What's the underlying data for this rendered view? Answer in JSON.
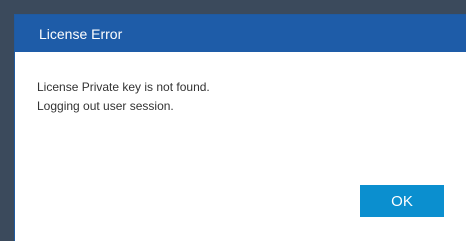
{
  "dialog": {
    "title": "License Error",
    "message_line1": "License Private key is not found.",
    "message_line2": "Logging out user session.",
    "ok_label": "OK"
  },
  "colors": {
    "titlebar": "#1e5ca8",
    "ok_button": "#0b8fcf",
    "backdrop": "#3b4a5c"
  }
}
